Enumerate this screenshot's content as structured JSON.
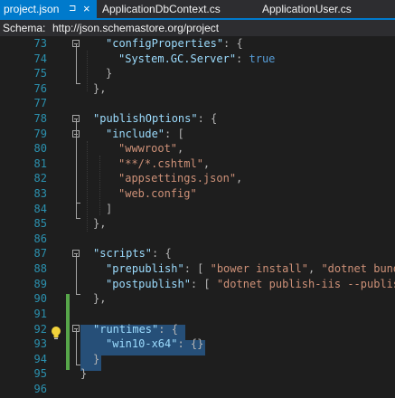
{
  "tabs": {
    "active": {
      "label": "project.json",
      "pin_glyph": "⊐",
      "close_glyph": "×"
    },
    "second": {
      "label": "ApplicationDbContext.cs"
    },
    "third": {
      "label": "ApplicationUser.cs"
    }
  },
  "schema_bar": {
    "label": "Schema:",
    "url": "http://json.schemastore.org/project"
  },
  "editor": {
    "lines": [
      {
        "n": "73",
        "t": ""
      },
      {
        "n": "74",
        "t": ""
      },
      {
        "n": "75",
        "t": ""
      },
      {
        "n": "76",
        "t": ""
      },
      {
        "n": "77",
        "t": ""
      },
      {
        "n": "78",
        "t": ""
      },
      {
        "n": "79",
        "t": ""
      },
      {
        "n": "80",
        "t": ""
      },
      {
        "n": "81",
        "t": ""
      },
      {
        "n": "82",
        "t": ""
      },
      {
        "n": "83",
        "t": ""
      },
      {
        "n": "84",
        "t": ""
      },
      {
        "n": "85",
        "t": ""
      },
      {
        "n": "86",
        "t": ""
      },
      {
        "n": "87",
        "t": ""
      },
      {
        "n": "88",
        "t": ""
      },
      {
        "n": "89",
        "t": ""
      },
      {
        "n": "90",
        "t": ""
      },
      {
        "n": "91",
        "t": ""
      },
      {
        "n": "92",
        "t": ""
      },
      {
        "n": "93",
        "t": ""
      },
      {
        "n": "94",
        "t": ""
      },
      {
        "n": "95",
        "t": ""
      },
      {
        "n": "96",
        "t": ""
      }
    ],
    "code": {
      "l73a": "\"configProperties\"",
      "l73b": ": {",
      "l74a": "\"System.GC.Server\"",
      "l74b": ": ",
      "l74c": "true",
      "l75": "}",
      "l76": "},",
      "l78a": "\"publishOptions\"",
      "l78b": ": {",
      "l79a": "\"include\"",
      "l79b": ": [",
      "l80": "\"wwwroot\"",
      "l80b": ",",
      "l81": "\"**/*.cshtml\"",
      "l81b": ",",
      "l82": "\"appsettings.json\"",
      "l82b": ",",
      "l83": "\"web.config\"",
      "l84": "]",
      "l85": "},",
      "l87a": "\"scripts\"",
      "l87b": ": {",
      "l88a": "\"prepublish\"",
      "l88b": ": [ ",
      "l88c": "\"bower install\"",
      "l88d": ", ",
      "l88e": "\"dotnet bundle",
      "l89a": "\"postpublish\"",
      "l89b": ": [ ",
      "l89c": "\"dotnet publish-iis --publish",
      "l90": "},",
      "l92a": "\"runtimes\"",
      "l92b": ": {",
      "l93a": "\"win10-x64\"",
      "l93b": ": {}",
      "l94": "}",
      "l95": "}"
    }
  },
  "icons": {
    "fold": "collapse-icon",
    "bulb": "lightbulb-icon"
  },
  "colors": {
    "accent": "#007acc",
    "line_number": "#2b91af",
    "key": "#9cdcfe",
    "string": "#ce9178",
    "keyword": "#569cd6",
    "selection": "#264f78",
    "change_bar": "#57a64a"
  }
}
